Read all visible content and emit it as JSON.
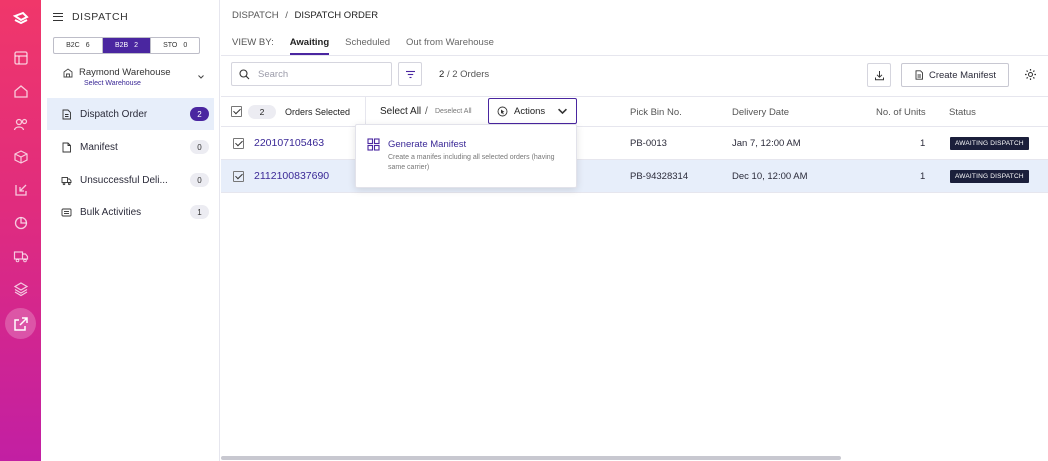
{
  "sidebar": {
    "title": "DISPATCH",
    "segments": [
      {
        "label": "B2C",
        "count": "6"
      },
      {
        "label": "B2B",
        "count": "2"
      },
      {
        "label": "STO",
        "count": "0"
      }
    ],
    "warehouse": {
      "name": "Raymond Warehouse",
      "action": "Select Warehouse"
    },
    "items": [
      {
        "label": "Dispatch Order",
        "count": "2"
      },
      {
        "label": "Manifest",
        "count": "0"
      },
      {
        "label": "Unsuccessful Deli...",
        "count": "0"
      },
      {
        "label": "Bulk Activities",
        "count": "1"
      }
    ]
  },
  "breadcrumb": {
    "parent": "DISPATCH",
    "separator": "/",
    "current": "DISPATCH ORDER"
  },
  "viewby": {
    "label": "VIEW BY:",
    "tabs": [
      {
        "label": "Awaiting"
      },
      {
        "label": "Scheduled"
      },
      {
        "label": "Out from Warehouse"
      }
    ]
  },
  "toolbar": {
    "search_placeholder": "Search",
    "count_current": "2",
    "count_rest": "/ 2 Orders",
    "create_label": "Create Manifest"
  },
  "table": {
    "selected_count": "2",
    "selected_label": "Orders Selected",
    "select_all": "Select All",
    "slash": "/",
    "deselect_all": "Deselect All",
    "actions_label": "Actions",
    "columns": {
      "pick_bin": "Pick Bin No.",
      "delivery_date": "Delivery Date",
      "units": "No. of Units",
      "status": "Status"
    },
    "rows": [
      {
        "order_id": "220107105463",
        "pick_bin": "PB-0013",
        "delivery_date": "Jan 7, 12:00 AM",
        "units": "1",
        "status": "AWAITING DISPATCH"
      },
      {
        "order_id": "2112100837690",
        "pick_bin": "PB-94328314",
        "delivery_date": "Dec 10, 12:00 AM",
        "units": "1",
        "status": "AWAITING DISPATCH"
      }
    ]
  },
  "actions_menu": {
    "title": "Generate Manifest",
    "description": "Create a manifes including all selected orders (having same carrier)"
  },
  "colors": {
    "accent": "#4a26a0",
    "rail_top": "#f0376a",
    "rail_bottom": "#c21fa3",
    "status_badge": "#1b1f3b"
  }
}
